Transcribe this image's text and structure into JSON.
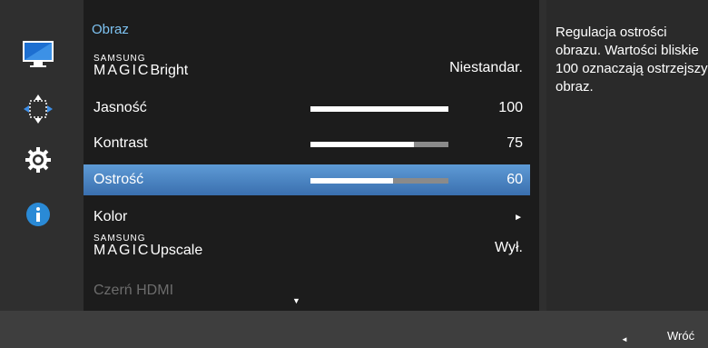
{
  "sidebar": {
    "icons": [
      {
        "name": "monitor-icon",
        "active": true
      },
      {
        "name": "resize-arrows-icon",
        "active": false
      },
      {
        "name": "gear-icon",
        "active": false
      },
      {
        "name": "info-icon",
        "active": false
      }
    ]
  },
  "menu": {
    "title": "Obraz",
    "items": [
      {
        "brand_top": "SAMSUNG",
        "brand_bottom": "MAGIC",
        "label": "Bright",
        "value": "Niestandar."
      },
      {
        "label": "Jasność",
        "value": "100",
        "level": 100
      },
      {
        "label": "Kontrast",
        "value": "75",
        "level": 75
      },
      {
        "label": "Ostrość",
        "value": "60",
        "level": 60,
        "selected": true
      },
      {
        "label": "Kolor",
        "value": "►"
      },
      {
        "brand_top": "SAMSUNG",
        "brand_bottom": "MAGIC",
        "label": "Upscale",
        "value": "Wył."
      },
      {
        "label": "Czerń HDMI",
        "value": "",
        "disabled": true
      }
    ],
    "scroll_indicator": "▼"
  },
  "help": {
    "text": "Regulacja ostrości obrazu. Wartości bliskie 100 oznaczają ostrzejszy obraz."
  },
  "footer": {
    "back_arrow": "◄",
    "back_label": "Wróć"
  },
  "colors": {
    "menu_title": "#7ec3f2",
    "selection": "#4a84c4",
    "info_blue": "#2a8ad6"
  }
}
